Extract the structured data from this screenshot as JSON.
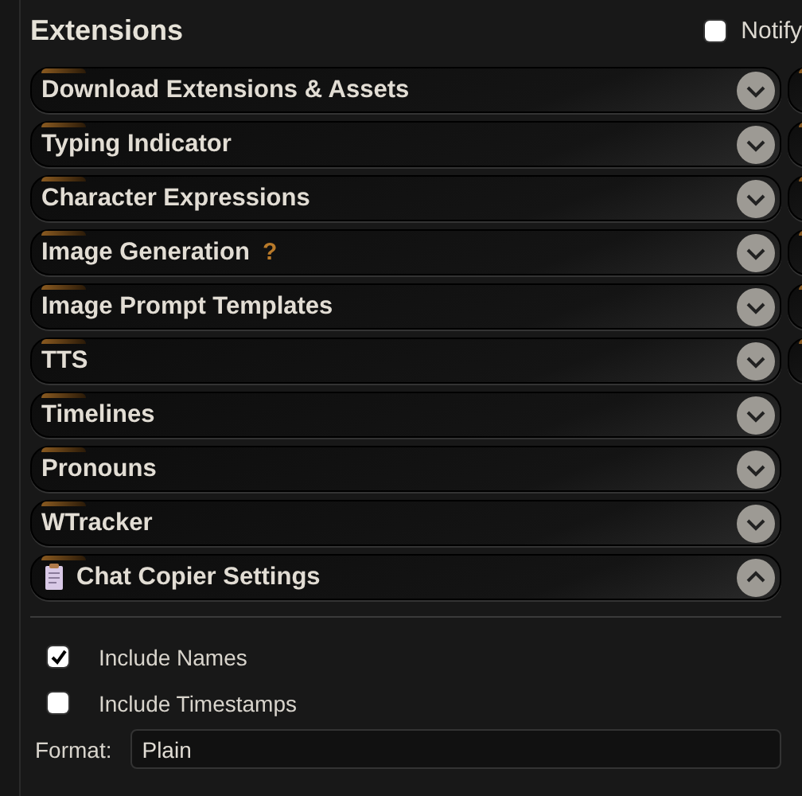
{
  "title": "Extensions",
  "notify": {
    "label": "Notify",
    "checked": false
  },
  "drawers": [
    {
      "kind": "plain",
      "label": "Download Extensions & Assets",
      "expanded": false
    },
    {
      "kind": "plain",
      "label": "Typing Indicator",
      "expanded": false
    },
    {
      "kind": "plain",
      "label": "Character Expressions",
      "expanded": false
    },
    {
      "kind": "plain",
      "label": "Image Generation",
      "help": "?",
      "expanded": false
    },
    {
      "kind": "plain",
      "label": "Image Prompt Templates",
      "expanded": false
    },
    {
      "kind": "plain",
      "label": "TTS",
      "expanded": false
    },
    {
      "kind": "plain",
      "label": "Timelines",
      "expanded": false
    },
    {
      "kind": "plain",
      "label": "Pronouns",
      "expanded": false
    },
    {
      "kind": "plain",
      "label": "WTracker",
      "expanded": false
    },
    {
      "kind": "with-icon",
      "label": "Chat Copier Settings",
      "expanded": true,
      "options": [
        {
          "label": "Include Names",
          "checked": true
        },
        {
          "label": "Include Timestamps",
          "checked": false
        }
      ],
      "format": {
        "label": "Format:",
        "value": "Plain"
      }
    }
  ],
  "right_drawers": [
    {
      "kind": "drawer"
    },
    {
      "kind": "drawer"
    },
    {
      "kind": "drawer"
    },
    {
      "kind": "drawer"
    },
    {
      "kind": "drawer"
    },
    {
      "kind": "drawer"
    }
  ]
}
